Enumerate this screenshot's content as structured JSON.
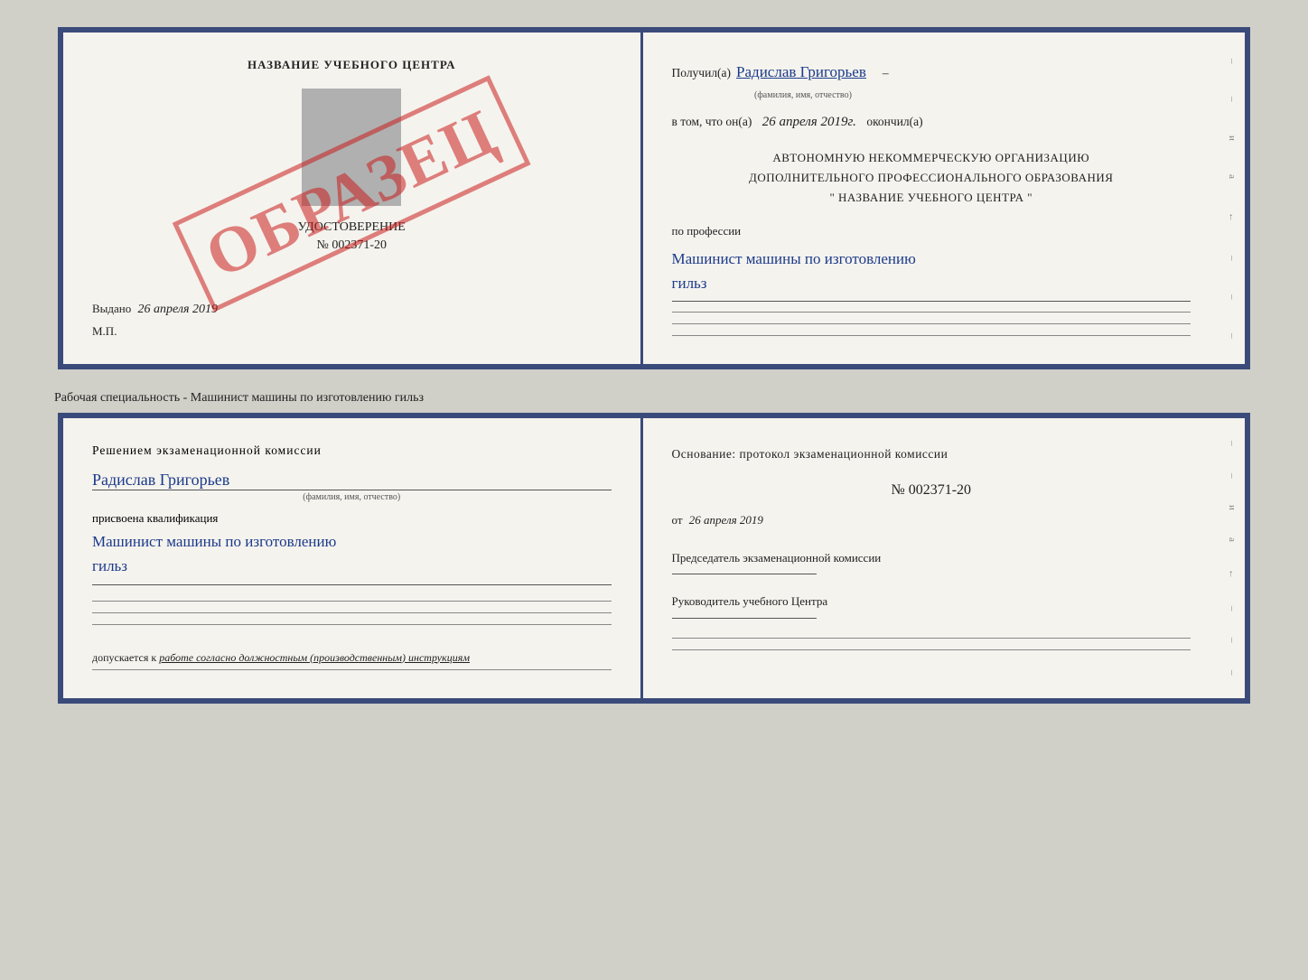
{
  "top_doc": {
    "left": {
      "title": "НАЗВАНИЕ УЧЕБНОГО ЦЕНТРА",
      "stamp_text": "ОБРАЗЕЦ",
      "udostoverenie_label": "УДОСТОВЕРЕНИЕ",
      "number": "№ 002371-20",
      "vydano": "Выдано",
      "vydano_date": "26 апреля 2019",
      "mp": "М.П."
    },
    "right": {
      "poluchil": "Получил(а)",
      "name": "Радислав Григорьев",
      "name_small": "(фамилия, имя, отчество)",
      "vtom_prefix": "в том, что он(а)",
      "date": "26 апреля 2019г.",
      "okonchil": "окончил(а)",
      "org_line1": "АВТОНОМНУЮ НЕКОММЕРЧЕСКУЮ ОРГАНИЗАЦИЮ",
      "org_line2": "ДОПОЛНИТЕЛЬНОГО ПРОФЕССИОНАЛЬНОГО ОБРАЗОВАНИЯ",
      "org_line3": "\"    НАЗВАНИЕ УЧЕБНОГО ЦЕНТРА    \"",
      "po_professii": "по профессии",
      "profession_line1": "Машинист машины по изготовлению",
      "profession_line2": "гильз"
    }
  },
  "subtitle": "Рабочая специальность - Машинист машины по изготовлению гильз",
  "bottom_doc": {
    "left": {
      "reshen": "Решением  экзаменационной  комиссии",
      "name": "Радислав Григорьев",
      "name_small": "(фамилия, имя, отчество)",
      "prisvoena": "присвоена квалификация",
      "kvalif_line1": "Машинист машины по изготовлению",
      "kvalif_line2": "гильз",
      "dopusk_prefix": "допускается к",
      "dopusk_text": "работе согласно должностным (производственным) инструкциям"
    },
    "right": {
      "osnovanie": "Основание: протокол экзаменационной  комиссии",
      "number": "№  002371-20",
      "ot_prefix": "от",
      "ot_date": "26 апреля 2019",
      "predsedatel_label": "Председатель экзаменационной комиссии",
      "rukovoditel_label": "Руководитель учебного Центра"
    }
  },
  "margin_chars": [
    "–",
    "–",
    "и",
    "а",
    "←",
    "–",
    "–",
    "–"
  ]
}
